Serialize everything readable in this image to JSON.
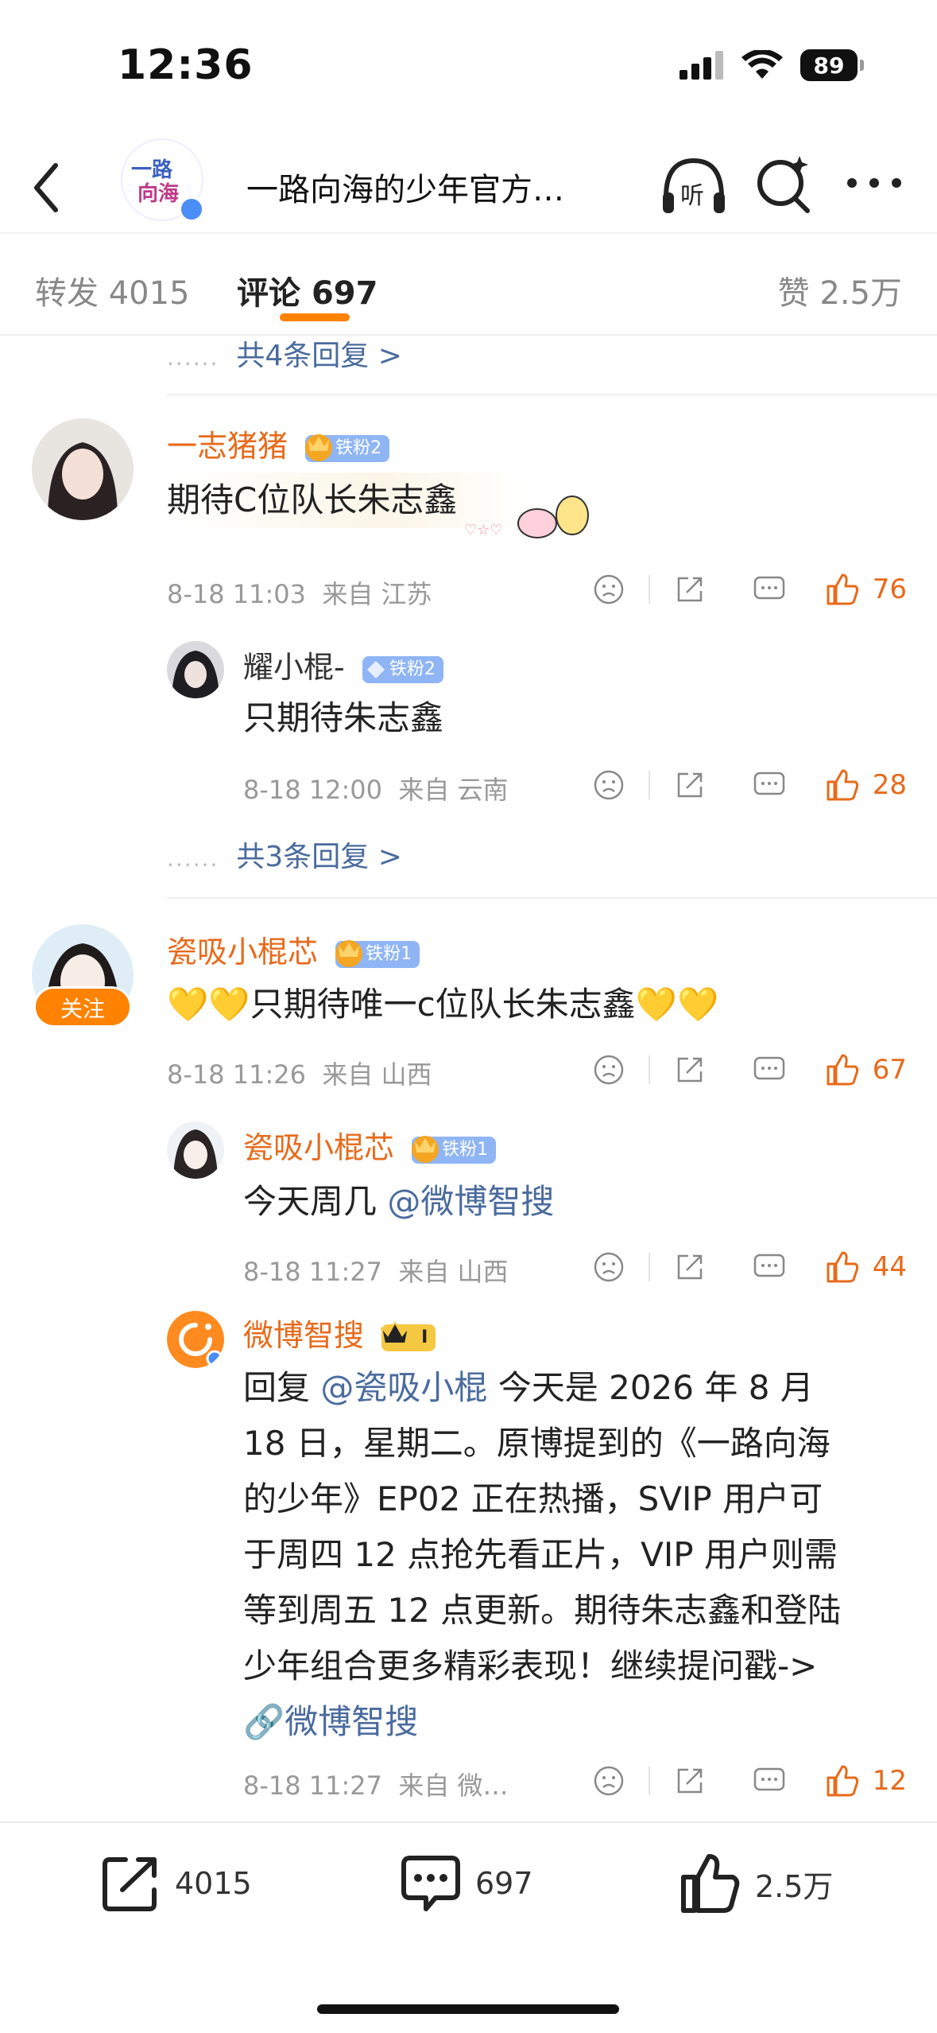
{
  "status": {
    "time": "12:36",
    "battery": "89"
  },
  "nav": {
    "title": "一路向海的少年官方…",
    "icons": [
      "back-icon",
      "listen-icon",
      "search-ai-icon",
      "more-icon"
    ]
  },
  "tabs": {
    "repost_label": "转发",
    "repost_count": "4015",
    "comment_label": "评论",
    "comment_count": "697",
    "like_label": "赞",
    "like_count": "2.5万"
  },
  "more_replies_top": "共4条回复 >",
  "colors": {
    "accent": "#ff8200",
    "username": "#e86a1a",
    "link": "#4a6b9e",
    "fanbadge": "#8fb5f5"
  },
  "comments": [
    {
      "user": "一志猪猪",
      "badge": "铁粉2",
      "text": "期待C位队长朱志鑫",
      "sticker": "pig-chick-sticker",
      "time": "8-18 11:03",
      "from": "来自 江苏",
      "likes": "76",
      "reply": {
        "user": "耀小棍-",
        "badge": "铁粉2",
        "text": "只期待朱志鑫",
        "time": "8-18 12:00",
        "from": "来自 云南",
        "likes": "28"
      },
      "more": "共3条回复 >"
    },
    {
      "user": "瓷吸小棍芯",
      "badge": "铁粉1",
      "follow": "关注",
      "text": "💛💛只期待唯一c位队长朱志鑫💛💛",
      "time": "8-18 11:26",
      "from": "来自 山西",
      "likes": "67",
      "replies": [
        {
          "user": "瓷吸小棍芯",
          "badge": "铁粉1",
          "text_prefix": "今天周几",
          "mention": "@微博智搜",
          "time": "8-18 11:27",
          "from": "来自 山西",
          "likes": "44"
        },
        {
          "user": "微博智搜",
          "badge": "I",
          "reply_label": "回复",
          "mention": "@瓷吸小棍",
          "lines": [
            "今天是 2026 年 8 月",
            "18 日，星期二。原博提到的《一路向海",
            "的少年》EP02 正在热播，SVIP 用户可",
            "于周四 12 点抢先看正片，VIP 用户则需",
            "等到周五 12 点更新。期待朱志鑫和登陆",
            "少年组合更多精彩表现！继续提问戳->"
          ],
          "link": "微博智搜",
          "time": "8-18 11:27",
          "from": "来自 微…",
          "likes": "12"
        }
      ]
    }
  ],
  "bottom_bar": {
    "repost": "4015",
    "comment": "697",
    "like": "2.5万"
  }
}
